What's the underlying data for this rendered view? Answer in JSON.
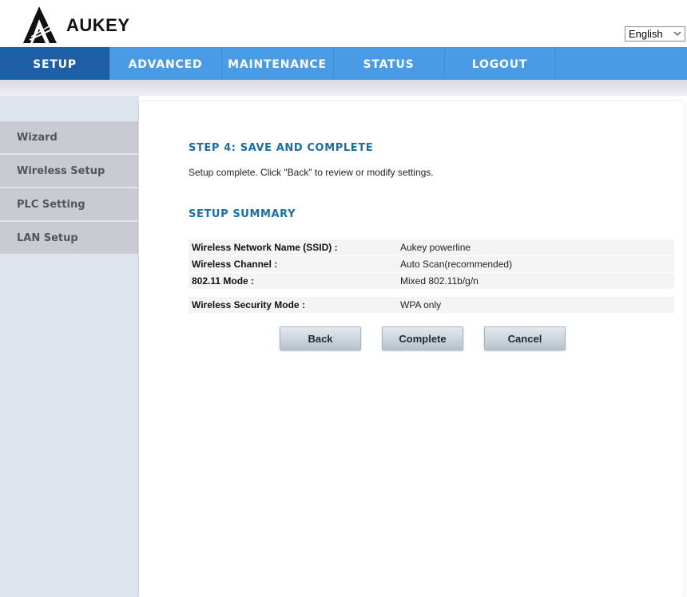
{
  "brand": {
    "name": "AUKEY"
  },
  "language": {
    "selected": "English"
  },
  "nav": {
    "items": [
      {
        "label": "SETUP"
      },
      {
        "label": "ADVANCED"
      },
      {
        "label": "MAINTENANCE"
      },
      {
        "label": "STATUS"
      },
      {
        "label": "LOGOUT"
      }
    ]
  },
  "sidebar": {
    "items": [
      {
        "label": "Wizard"
      },
      {
        "label": "Wireless Setup"
      },
      {
        "label": "PLC Setting"
      },
      {
        "label": "LAN Setup"
      }
    ]
  },
  "main": {
    "step_title": "STEP 4: SAVE AND COMPLETE",
    "description": "Setup complete. Click \"Back\" to review or modify settings.",
    "summary_title": "SETUP SUMMARY",
    "summary": [
      {
        "label": "Wireless Network Name (SSID) :",
        "value": "Aukey powerline"
      },
      {
        "label": "Wireless Channel :",
        "value": "Auto Scan(recommended)"
      },
      {
        "label": "802.11 Mode :",
        "value": "Mixed 802.11b/g/n"
      },
      {
        "label": "Wireless Security Mode :",
        "value": "WPA only"
      }
    ],
    "buttons": {
      "back": "Back",
      "complete": "Complete",
      "cancel": "Cancel"
    }
  },
  "colors": {
    "nav_bg": "#4a9be6",
    "nav_active": "#1f5fa8",
    "title": "#1a6fa0",
    "sidebar_item": "#c8ccd2"
  }
}
